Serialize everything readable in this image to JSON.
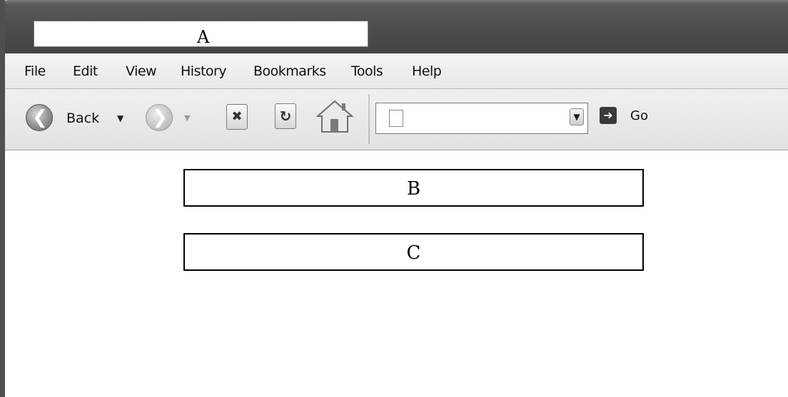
{
  "window": {
    "title_tab_label": "A"
  },
  "menu": {
    "items": [
      "File",
      "Edit",
      "View",
      "History",
      "Bookmarks",
      "Tools",
      "Help"
    ]
  },
  "toolbar": {
    "back_label": "Back",
    "go_label": "Go",
    "address_value": "",
    "icons": [
      "back-arrow-icon",
      "dropdown-triangle-icon",
      "forward-arrow-icon",
      "stop-icon",
      "reload-icon",
      "home-icon",
      "page-icon",
      "chevron-down-icon",
      "go-arrow-icon"
    ]
  },
  "content": {
    "box_b_label": "B",
    "box_c_label": "C"
  }
}
